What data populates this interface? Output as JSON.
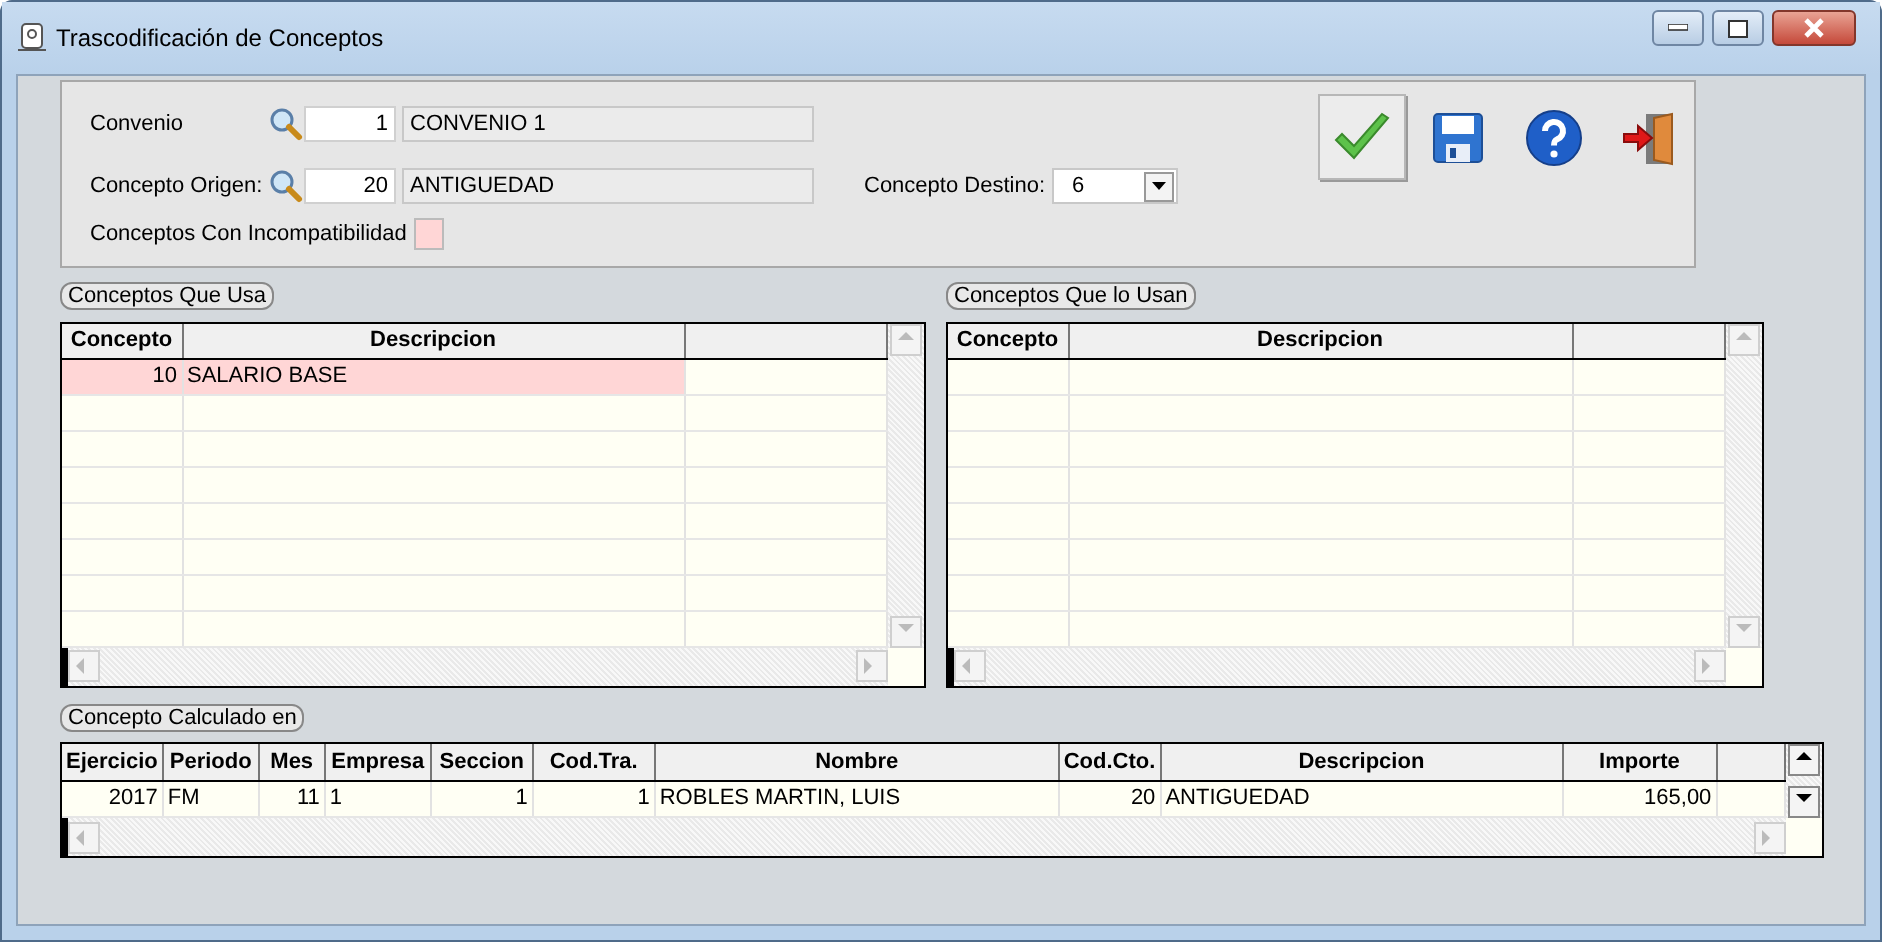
{
  "window": {
    "title": "Trascodificación de Conceptos"
  },
  "form": {
    "convenio": {
      "label": "Convenio",
      "code": "1",
      "description": "CONVENIO 1"
    },
    "concepto_origen": {
      "label": "Concepto Origen:",
      "code": "20",
      "description": "ANTIGUEDAD"
    },
    "concepto_destino": {
      "label": "Concepto Destino:",
      "value": "6"
    },
    "incompatibilidad": {
      "label": "Conceptos Con Incompatibilidad",
      "color": "#ffd6d6"
    }
  },
  "toolbar": [
    {
      "kind": "accept",
      "focused": true
    },
    {
      "kind": "save",
      "focused": false
    },
    {
      "kind": "help",
      "focused": false
    },
    {
      "kind": "exit",
      "focused": false
    }
  ],
  "grids": [
    {
      "title": "Conceptos Que Usa",
      "columns": [
        "Concepto",
        "Descripcion"
      ],
      "rows": [
        {
          "cells": [
            "10",
            "SALARIO BASE"
          ],
          "incompatible": true
        }
      ]
    },
    {
      "title": "Conceptos Que lo Usan",
      "columns": [
        "Concepto",
        "Descripcion"
      ]
    }
  ],
  "calculado": {
    "title": "Concepto Calculado en",
    "columns": [
      "Ejercicio",
      "Periodo",
      "Mes",
      "Empresa",
      "Seccion",
      "Cod.Tra.",
      "Nombre",
      "Cod.Cto.",
      "Descripcion",
      "Importe"
    ],
    "rows": [
      {
        "cells": [
          "2017",
          "FM",
          "11",
          "1",
          "1",
          "1",
          "ROBLES MARTIN, LUIS",
          "20",
          "ANTIGUEDAD",
          "165,00"
        ],
        "incompatible": false
      }
    ]
  }
}
